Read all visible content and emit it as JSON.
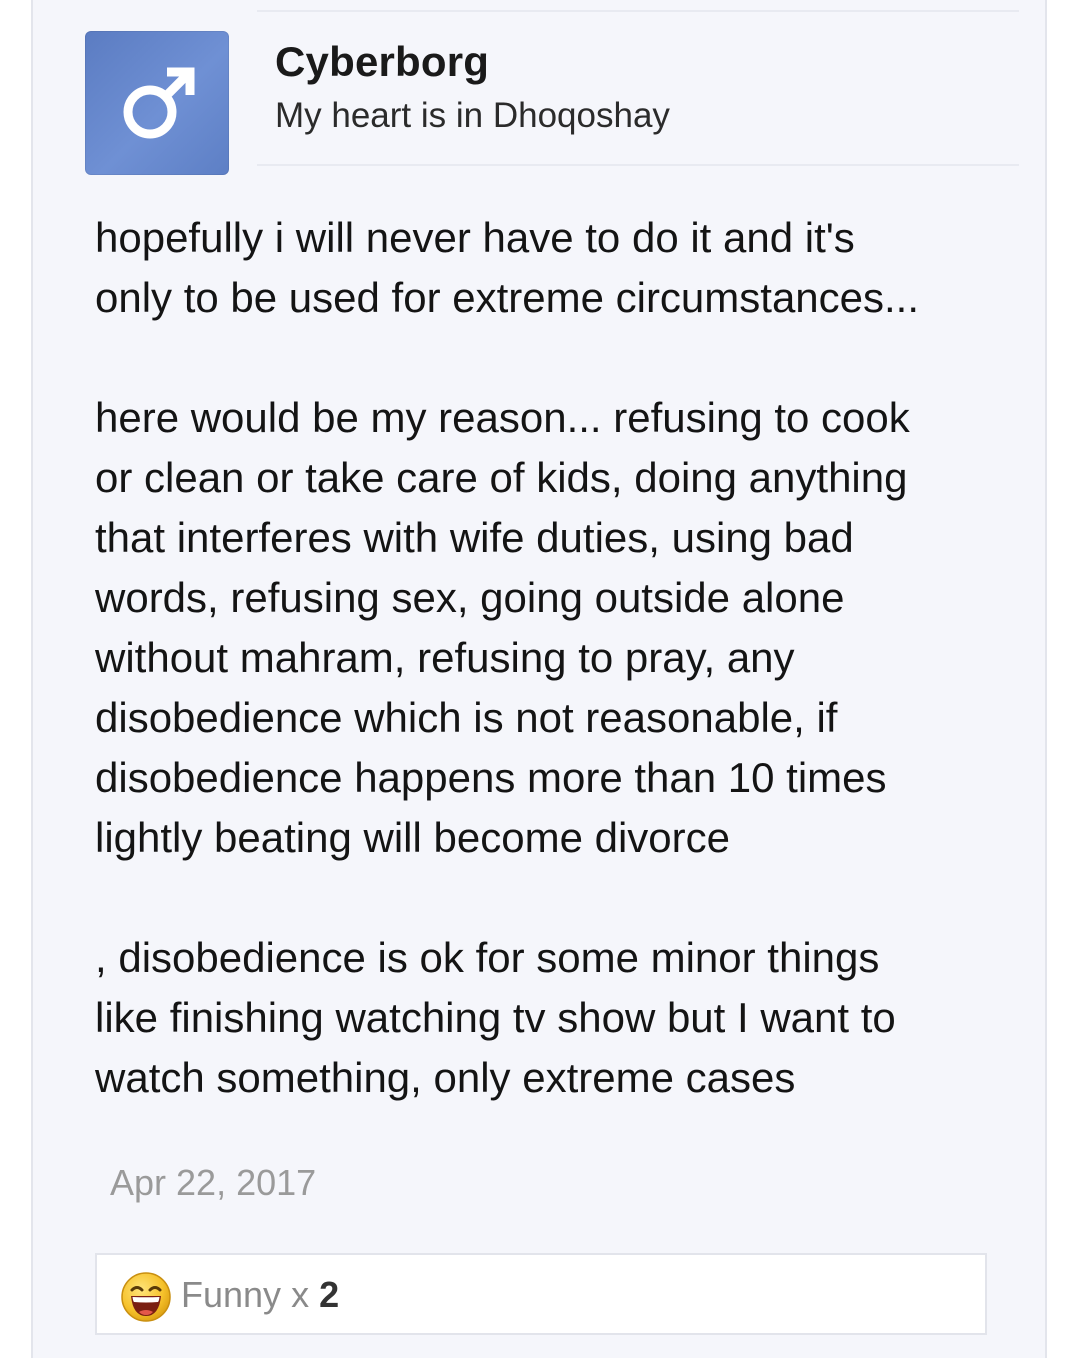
{
  "post": {
    "author": {
      "username": "Cyberborg",
      "title": "My heart is in Dhoqoshay",
      "avatar_icon": "male-symbol-icon",
      "avatar_color": "#6a8ad0"
    },
    "message_paragraphs": [
      "hopefully i will never have to do it and it's\nonly to be used for extreme circumstances...",
      "here would be my reason... refusing to cook\nor clean or take care of kids, doing anything\nthat interferes with wife duties, using bad\nwords, refusing sex, going outside alone\nwithout mahram, refusing to pray, any\ndisobedience which is not reasonable, if\ndisobedience happens more than 10 times\nlightly beating will become divorce",
      ", disobedience is ok for some minor things\nlike finishing watching tv show but I want to\nwatch something, only extreme cases"
    ],
    "date": "Apr 22, 2017",
    "reactions": {
      "icon": "laughing-face-icon",
      "label": "Funny",
      "separator": " x ",
      "count": "2"
    }
  }
}
